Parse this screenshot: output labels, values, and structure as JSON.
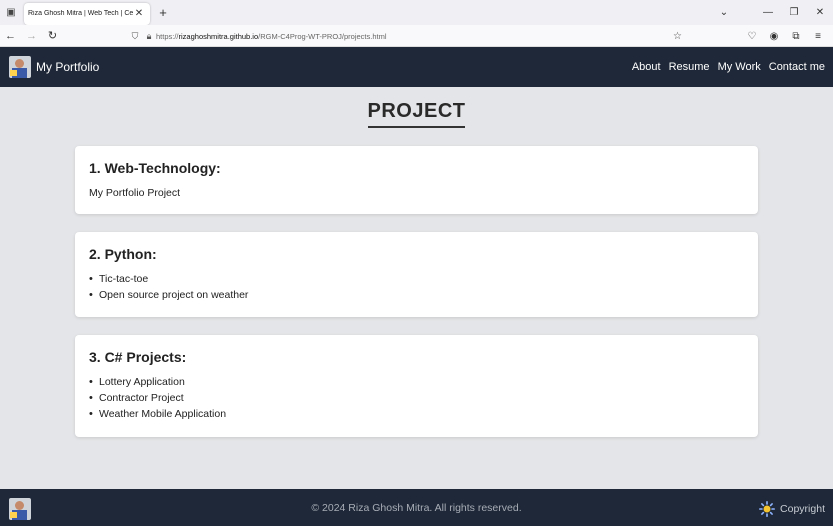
{
  "browser": {
    "tab_title": "Riza Ghosh Mitra | Web Tech | Cert",
    "url_host": "rizaghoshmitra.github.io",
    "url_prefix": "https://",
    "url_path": "/RGM-C4Prog-WT-PROJ/projects.html"
  },
  "site": {
    "brand": "My Portfolio",
    "nav": [
      "About",
      "Resume",
      "My Work",
      "Contact me"
    ]
  },
  "page": {
    "title": "PROJECT",
    "sections": [
      {
        "heading": "1. Web-Technology:",
        "text": "My Portfolio Project"
      },
      {
        "heading": "2. Python:",
        "items": [
          "Tic-tac-toe",
          "Open source project on weather"
        ]
      },
      {
        "heading": "3. C# Projects:",
        "items": [
          "Lottery Application",
          "Contractor Project",
          "Weather Mobile Application"
        ]
      }
    ]
  },
  "footer": {
    "text": "© 2024 Riza Ghosh Mitra. All rights reserved.",
    "copyright_label": "Copyright"
  },
  "colors": {
    "nav_bg": "#1e2838",
    "page_bg": "#e4e5e8",
    "card_bg": "#ffffff"
  }
}
